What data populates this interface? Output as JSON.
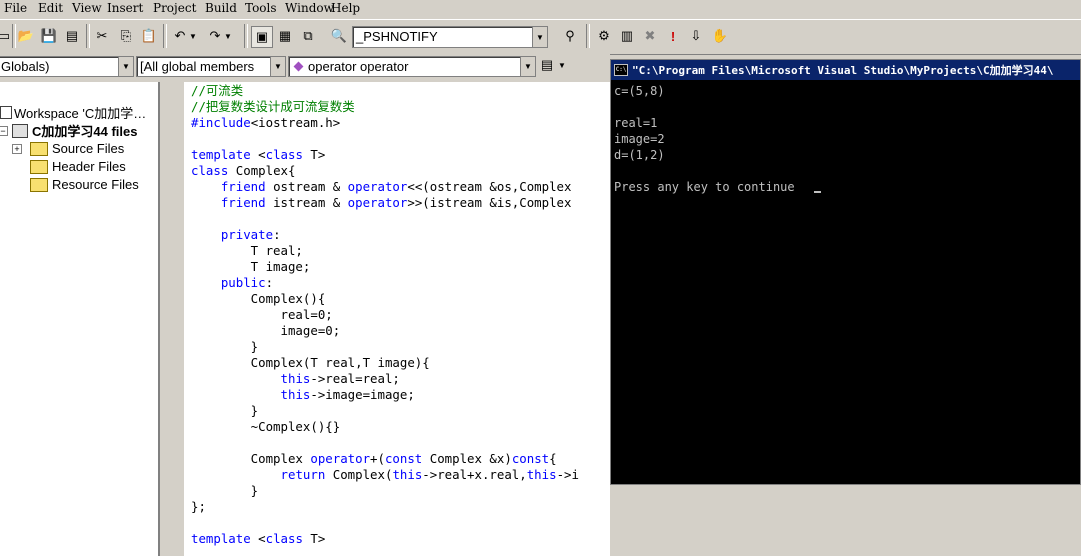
{
  "menu": [
    "File",
    "Edit",
    "View",
    "Insert",
    "Project",
    "Build",
    "Tools",
    "Window",
    "Help"
  ],
  "toolbar": {
    "find_combo_value": "_PSHNOTIFY"
  },
  "wizard": {
    "class_combo": "Globals)",
    "filter_combo": "[All global members",
    "member_combo": "operator operator"
  },
  "workspace": {
    "root": "Workspace 'C加加学…",
    "project": "C加加学习44 files",
    "folders": [
      "Source Files",
      "Header Files",
      "Resource Files"
    ]
  },
  "code_lines": [
    "//可流类",
    "//把复数类设计成可流复数类",
    "#include<iostream.h>",
    "",
    "template <class T>",
    "class Complex{",
    "    friend ostream & operator<<(ostream &os,Complex",
    "    friend istream & operator>>(istream &is,Complex",
    "",
    "    private:",
    "        T real;",
    "        T image;",
    "    public:",
    "        Complex(){",
    "            real=0;",
    "            image=0;",
    "        }",
    "        Complex(T real,T image){",
    "            this->real=real;",
    "            this->image=image;",
    "        }",
    "        ~Complex(){}",
    "",
    "        Complex operator+(const Complex &x)const{",
    "            return Complex(this->real+x.real,this->i",
    "        }",
    "};",
    "",
    "template <class T>"
  ],
  "console": {
    "title": "\"C:\\Program Files\\Microsoft Visual Studio\\MyProjects\\C加加学习44\\",
    "lines": [
      "c=(5,8)",
      "",
      "real=1",
      "image=2",
      "d=(1,2)",
      "",
      "Press any key to continue"
    ]
  }
}
